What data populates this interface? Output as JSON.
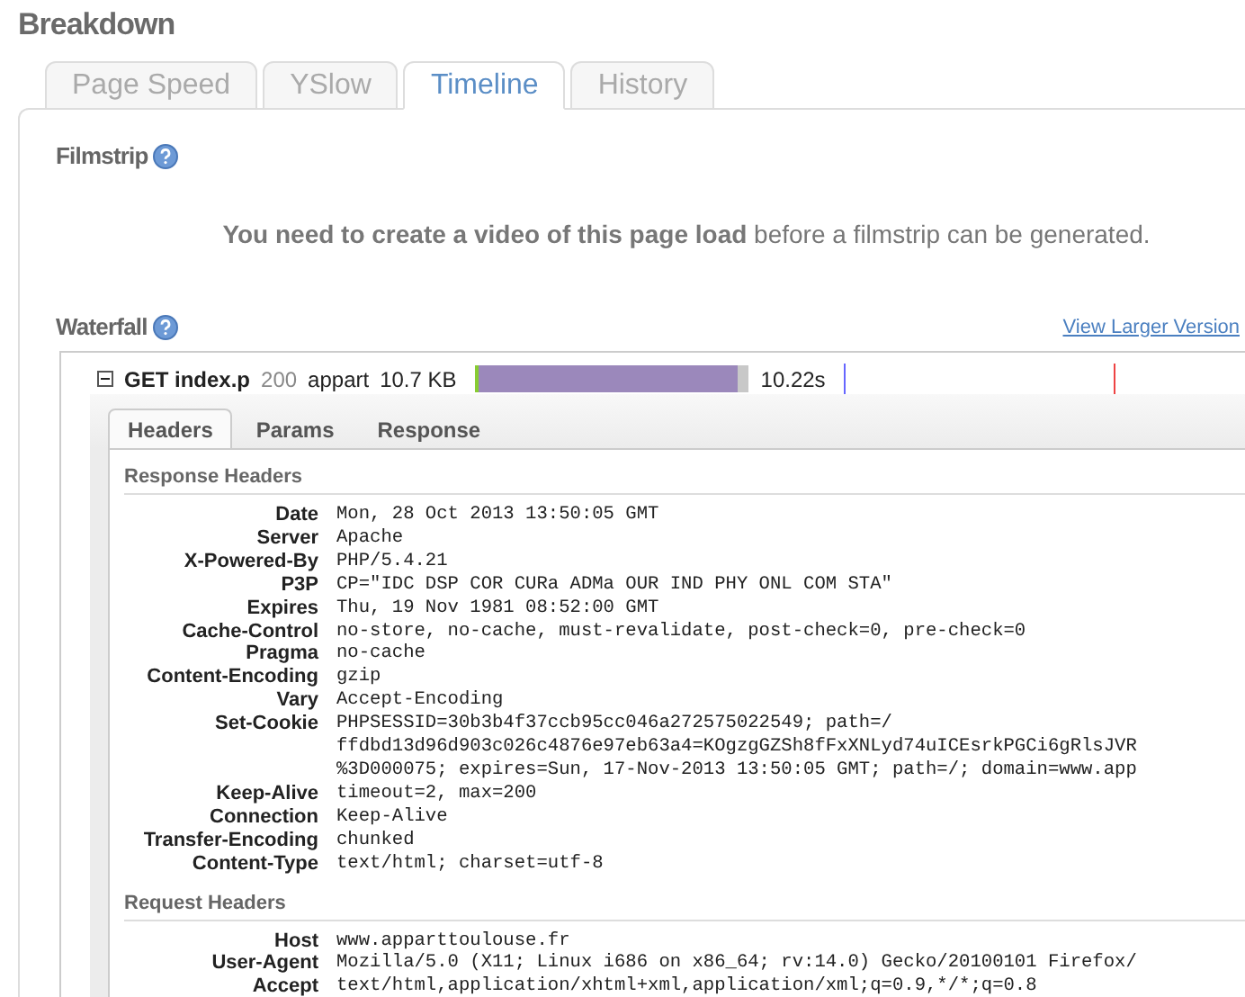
{
  "title": "Breakdown",
  "tabs": [
    {
      "label": "Page Speed",
      "selected": false
    },
    {
      "label": "YSlow",
      "selected": false
    },
    {
      "label": "Timeline",
      "selected": true
    },
    {
      "label": "History",
      "selected": false
    }
  ],
  "filmstrip": {
    "heading": "Filmstrip",
    "message": "**You need to create a video of this page load** before a filmstrip can be generated."
  },
  "waterfall": {
    "heading": "Waterfall",
    "link": "View Larger Version",
    "request": {
      "expanded": true,
      "method_file": "GET index.p",
      "status": "200",
      "domain": "appart",
      "size": "10.7 KB",
      "time": "10.22s"
    },
    "detail_tabs": [
      {
        "label": "Headers",
        "selected": true
      },
      {
        "label": "Params",
        "selected": false
      },
      {
        "label": "Response",
        "selected": false
      }
    ],
    "sections": [
      {
        "title": "Response Headers",
        "headers": [
          {
            "name": "Date",
            "value": "Mon, 28 Oct 2013 13:50:05 GMT"
          },
          {
            "name": "Server",
            "value": "Apache"
          },
          {
            "name": "X-Powered-By",
            "value": "PHP/5.4.21"
          },
          {
            "name": "P3P",
            "value": "CP=\"IDC DSP COR CURa ADMa OUR IND PHY ONL COM STA\""
          },
          {
            "name": "Expires",
            "value": "Thu, 19 Nov 1981 08:52:00 GMT"
          },
          {
            "name": "Cache-Control",
            "value": "no-store, no-cache, must-revalidate, post-check=0, pre-check=0"
          },
          {
            "name": "Pragma",
            "value": "no-cache"
          },
          {
            "name": "Content-Encoding",
            "value": "gzip"
          },
          {
            "name": "Vary",
            "value": "Accept-Encoding"
          },
          {
            "name": "Set-Cookie",
            "value": "PHPSESSID=30b3b4f37ccb95cc046a272575022549; path=/\nffdbd13d96d903c026c4876e97eb63a4=KOgzgGZSh8fFxXNLyd74uICEsrkPGCi6gRlsJVR\n%3D000075; expires=Sun, 17-Nov-2013 13:50:05 GMT; path=/; domain=www.app"
          },
          {
            "name": "Keep-Alive",
            "value": "timeout=2, max=200"
          },
          {
            "name": "Connection",
            "value": "Keep-Alive"
          },
          {
            "name": "Transfer-Encoding",
            "value": "chunked"
          },
          {
            "name": "Content-Type",
            "value": "text/html; charset=utf-8"
          }
        ]
      },
      {
        "title": "Request Headers",
        "headers": [
          {
            "name": "Host",
            "value": "www.apparttoulouse.fr"
          },
          {
            "name": "User-Agent",
            "value": "Mozilla/5.0 (X11; Linux i686 on x86_64; rv:14.0) Gecko/20100101 Firefox/"
          },
          {
            "name": "Accept",
            "value": "text/html,application/xhtml+xml,application/xml;q=0.9,*/*;q=0.8"
          }
        ]
      }
    ]
  }
}
